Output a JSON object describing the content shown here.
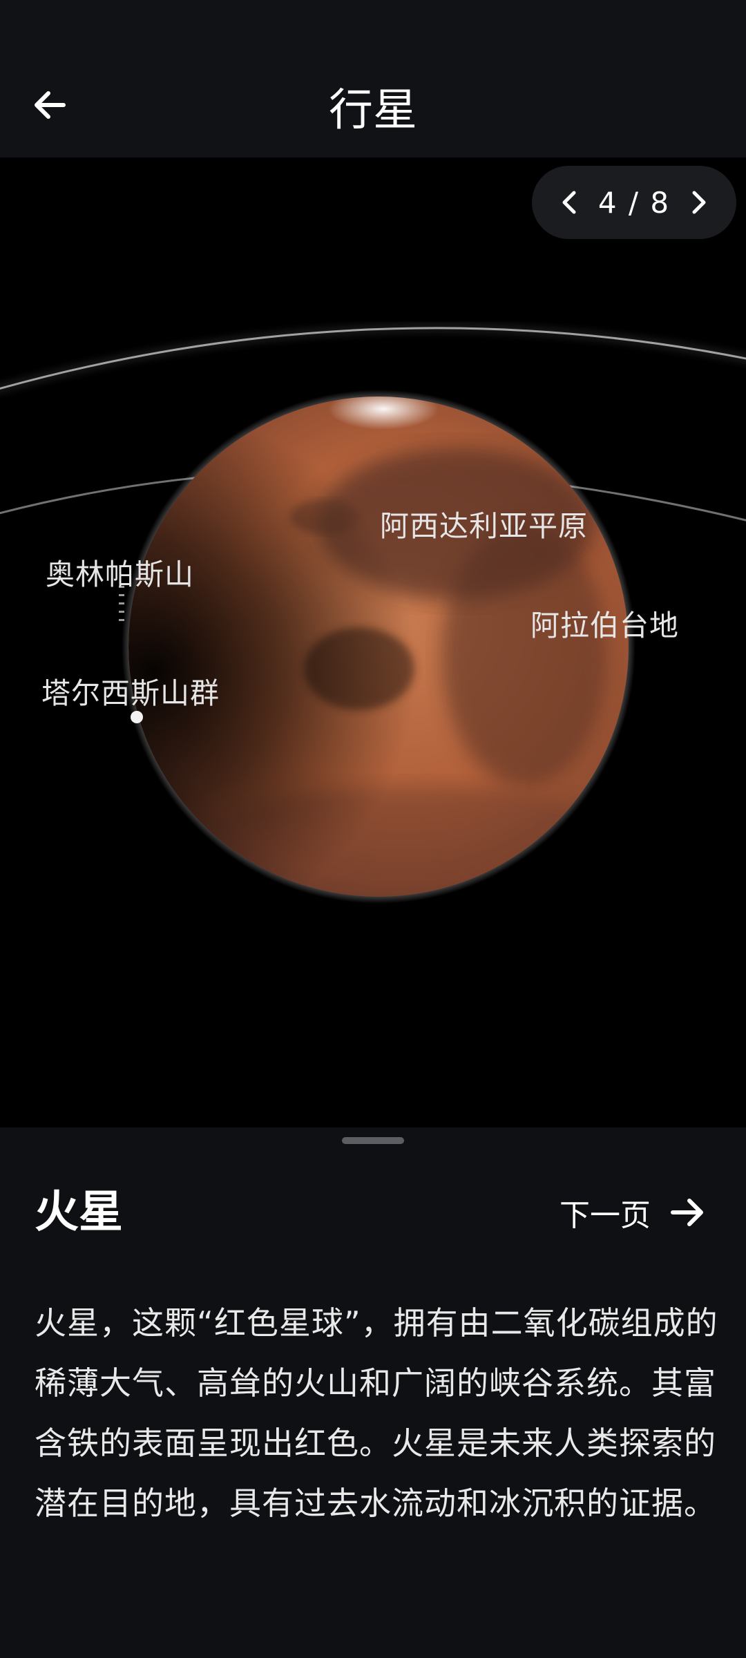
{
  "header": {
    "title": "行星",
    "back_icon": "arrow-left-icon"
  },
  "viewer": {
    "pager": {
      "current": 4,
      "total": 8,
      "text": "4 / 8",
      "prev_icon": "chevron-left-icon",
      "next_icon": "chevron-right-icon"
    },
    "labels": {
      "acidalia": "阿西达利亚平原",
      "olympus": "奥林帕斯山",
      "arabia": "阿拉伯台地",
      "tharsis": "塔尔西斯山群"
    },
    "colors": {
      "planet_base": "#b8653e",
      "planet_dark": "#4a2a1e",
      "orbit": "#bfbfbf"
    }
  },
  "sheet": {
    "planet_name": "火星",
    "next_label": "下一页",
    "next_icon": "arrow-right-icon",
    "description": "火星，这颗“红色星球”，拥有由二氧化碳组成的稀薄大气、高耸的火山和广阔的峡谷系统。其富含铁的表面呈现出红色。火星是未来人类探索的潜在目的地，具有过去水流动和冰沉积的证据。"
  }
}
